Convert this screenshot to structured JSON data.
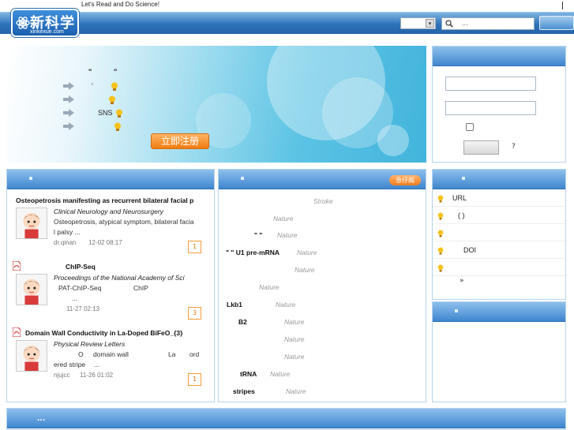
{
  "header": {
    "tagline": "Let's Read and Do Science!",
    "top_divider": "|",
    "logo_name": "新科学",
    "logo_domain": "xinkexue.com",
    "search": {
      "select_arrow": "▾",
      "icon": "search-icon",
      "placeholder": "..."
    }
  },
  "banner": {
    "quote_open": "\"",
    "quote_close": "\"",
    "rows": [
      {
        "text": "'"
      },
      {
        "text": ""
      },
      {
        "text": "SNS"
      },
      {
        "text": ""
      }
    ],
    "register_label": "立即注册"
  },
  "login": {
    "help_label": "?"
  },
  "recommended": {
    "items": [
      {
        "title": "Osteopetrosis manifesting as recurrent bilateral facial p",
        "journal": "Clinical Neurology and Neurosurgery",
        "line1": "Osteopetrosis, atypical symptom, bilateral facia",
        "line2": "l palsy ...",
        "user": "dr.qinan",
        "time": "12-02 08:17",
        "count": "1",
        "has_pdf": false
      },
      {
        "title": "ChIP-Seq",
        "journal": "Proceedings of the National Academy of Sci",
        "line1": "PAT-ChIP-Seq",
        "line1b": "ChIP",
        "line2": "...",
        "user": "",
        "time": "11-27 02:13",
        "count": "3",
        "has_pdf": true
      },
      {
        "title": "Domain Wall Conductivity in La-Doped BiFeO_{3}",
        "journal": "Physical Review Letters",
        "line1": "O",
        "line1b": "domain wall",
        "line1c": "La",
        "line1d": "ord",
        "line2": "ered stripe",
        "line2b": "...",
        "user": "njujcc",
        "time": "11-26 01:02",
        "count": "1",
        "has_pdf": true
      }
    ]
  },
  "translate": {
    "help_badge": "急仔阁",
    "rows": [
      {
        "bold": "",
        "source": "Stroke"
      },
      {
        "bold": "",
        "source": "Nature"
      },
      {
        "bold": "\"    \"",
        "source": "Nature"
      },
      {
        "bold": "\"    \" U1    pre-mRNA",
        "source": "Nature"
      },
      {
        "bold": "",
        "source": "Nature"
      },
      {
        "bold": "",
        "source": "Nature"
      },
      {
        "bold": "Lkb1",
        "source": "Nature"
      },
      {
        "bold": "B2",
        "source": "Nature"
      },
      {
        "bold": "",
        "source": "Nature"
      },
      {
        "bold": "",
        "source": "Nature"
      },
      {
        "bold": "tRNA",
        "source": "Nature"
      },
      {
        "bold": "stripes",
        "source": "Nature"
      }
    ]
  },
  "side": {
    "rows": [
      {
        "text": "URL"
      },
      {
        "text": "(    )"
      },
      {
        "text": ""
      },
      {
        "text": "DOI"
      },
      {
        "text": ""
      }
    ],
    "more": "»"
  },
  "bottom": {
    "title": "..."
  },
  "colors": {
    "nav_blue": "#2d73b9",
    "panel_head": "#3f86cf",
    "accent_orange": "#f07c11"
  }
}
